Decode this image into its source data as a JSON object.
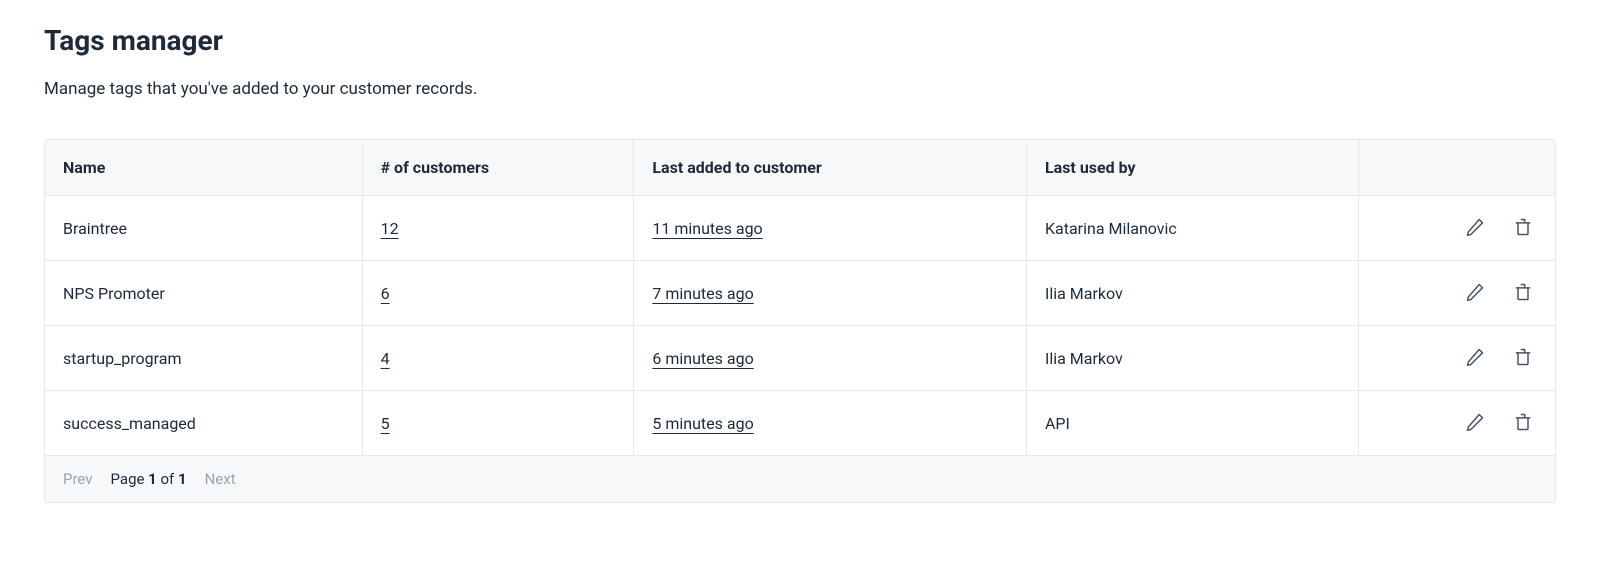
{
  "page": {
    "title": "Tags manager",
    "description": "Manage tags that you've added to your customer records."
  },
  "table": {
    "headers": {
      "name": "Name",
      "count": "# of customers",
      "last_added": "Last added to customer",
      "used_by": "Last used by"
    },
    "rows": [
      {
        "name": "Braintree",
        "count": "12",
        "last_added": "11 minutes ago",
        "used_by": "Katarina Milanovic"
      },
      {
        "name": "NPS Promoter",
        "count": "6",
        "last_added": "7 minutes ago",
        "used_by": "Ilia Markov"
      },
      {
        "name": "startup_program",
        "count": "4",
        "last_added": "6 minutes ago",
        "used_by": "Ilia Markov"
      },
      {
        "name": "success_managed",
        "count": "5",
        "last_added": "5 minutes ago",
        "used_by": "API"
      }
    ]
  },
  "pagination": {
    "prev": "Prev",
    "next": "Next",
    "page_prefix": "Page ",
    "current": "1",
    "of": " of ",
    "total": "1"
  }
}
